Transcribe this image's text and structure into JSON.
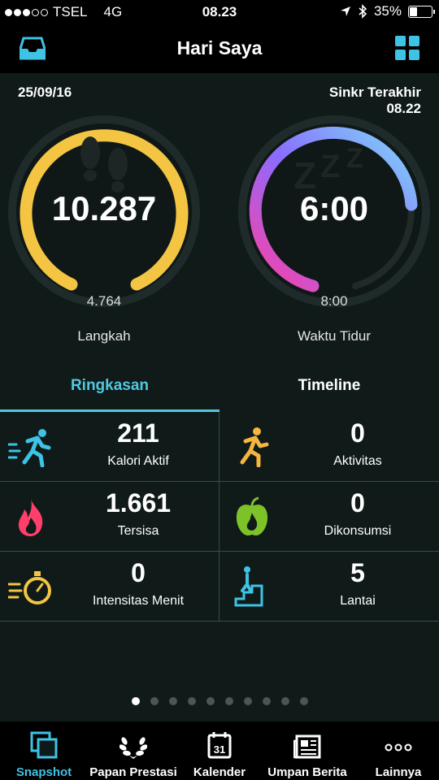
{
  "status": {
    "carrier": "TSEL",
    "network": "4G",
    "time": "08.23",
    "battery": "35%",
    "battery_level": 0.35
  },
  "header": {
    "title": "Hari Saya"
  },
  "summary": {
    "date": "25/09/16",
    "sync_label": "Sinkr Terakhir",
    "sync_time": "08.22"
  },
  "rings": {
    "steps": {
      "value": "10.287",
      "goal": "4.764",
      "label": "Langkah",
      "color": "#f4c542"
    },
    "sleep": {
      "value": "6:00",
      "goal": "8:00",
      "label": "Waktu Tidur",
      "progress": 0.75
    }
  },
  "tabs": {
    "summary": "Ringkasan",
    "timeline": "Timeline"
  },
  "stats": [
    {
      "value": "211",
      "label": "Kalori Aktif",
      "icon": "running-person-icon"
    },
    {
      "value": "0",
      "label": "Aktivitas",
      "icon": "runner-icon"
    },
    {
      "value": "1.661",
      "label": "Tersisa",
      "icon": "flame-icon"
    },
    {
      "value": "0",
      "label": "Dikonsumsi",
      "icon": "apple-icon"
    },
    {
      "value": "0",
      "label": "Intensitas Menit",
      "icon": "stopwatch-icon"
    },
    {
      "value": "5",
      "label": "Lantai",
      "icon": "stairs-icon"
    }
  ],
  "pager": {
    "pages": 10,
    "current": 1
  },
  "tabbar": [
    {
      "label": "Snapshot",
      "icon": "snapshot-icon"
    },
    {
      "label": "Papan Prestasi",
      "icon": "laurel-icon"
    },
    {
      "label": "Kalender",
      "icon": "calendar-icon",
      "icon_text": "31"
    },
    {
      "label": "Umpan Berita",
      "icon": "newspaper-icon"
    },
    {
      "label": "Lainnya",
      "icon": "more-icon"
    }
  ],
  "colors": {
    "accent": "#3ec3e4",
    "steps_ring": "#f4c542",
    "sleep_gradient": [
      "#ff3fa4",
      "#8a6cff",
      "#7fd8f7"
    ]
  }
}
